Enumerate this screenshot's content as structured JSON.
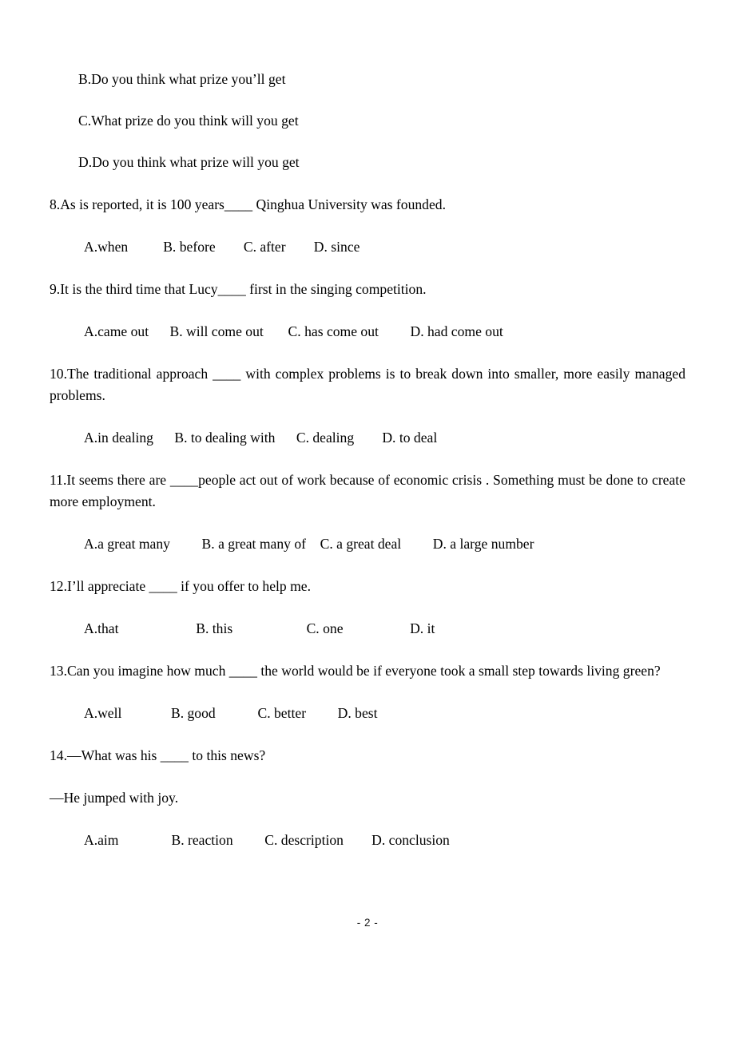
{
  "document": {
    "page_number_label": "- 2 -"
  },
  "carryover_choices": [
    {
      "id": "B",
      "text": "B.Do you think what prize you’ll get"
    },
    {
      "id": "C",
      "text": "C.What prize do you think will you get"
    },
    {
      "id": "D",
      "text": "D.Do you think what prize will you get"
    }
  ],
  "questions": [
    {
      "number": "8",
      "stem": "8.As is reported, it is 100 years____ Qinghua University was founded.",
      "justified": false,
      "options_line": "A.when          B. before        C. after        D. since"
    },
    {
      "number": "9",
      "stem": "9.It is the third time that Lucy____ first in the singing competition.",
      "justified": false,
      "options_line": "A.came out      B. will come out       C. has come out         D. had come out"
    },
    {
      "number": "10",
      "stem": "10.The traditional approach ____ with complex problems is to break down into smaller, more easily managed problems.",
      "justified": true,
      "options_line": "A.in dealing      B. to dealing with      C. dealing        D. to deal"
    },
    {
      "number": "11",
      "stem": "11.It seems there are ____people act out of work because of economic crisis . Something must be done to create more employment.",
      "justified": true,
      "options_line": "A.a great many         B. a great many of    C. a great deal         D. a large number"
    },
    {
      "number": "12",
      "stem": "12.I’ll appreciate ____ if you offer to help me.",
      "justified": false,
      "options_line": "A.that                      B. this                     C. one                   D. it"
    },
    {
      "number": "13",
      "stem": "13.Can you imagine how much ____ the world would be if everyone took a small step towards living green?",
      "justified": true,
      "options_line": "A.well              B. good            C. better         D. best"
    },
    {
      "number": "14",
      "stem": "14.—What was his ____ to this news?",
      "justified": false,
      "dialog_reply": "—He jumped with joy.",
      "options_line": "A.aim               B. reaction         C. description        D. conclusion"
    }
  ]
}
